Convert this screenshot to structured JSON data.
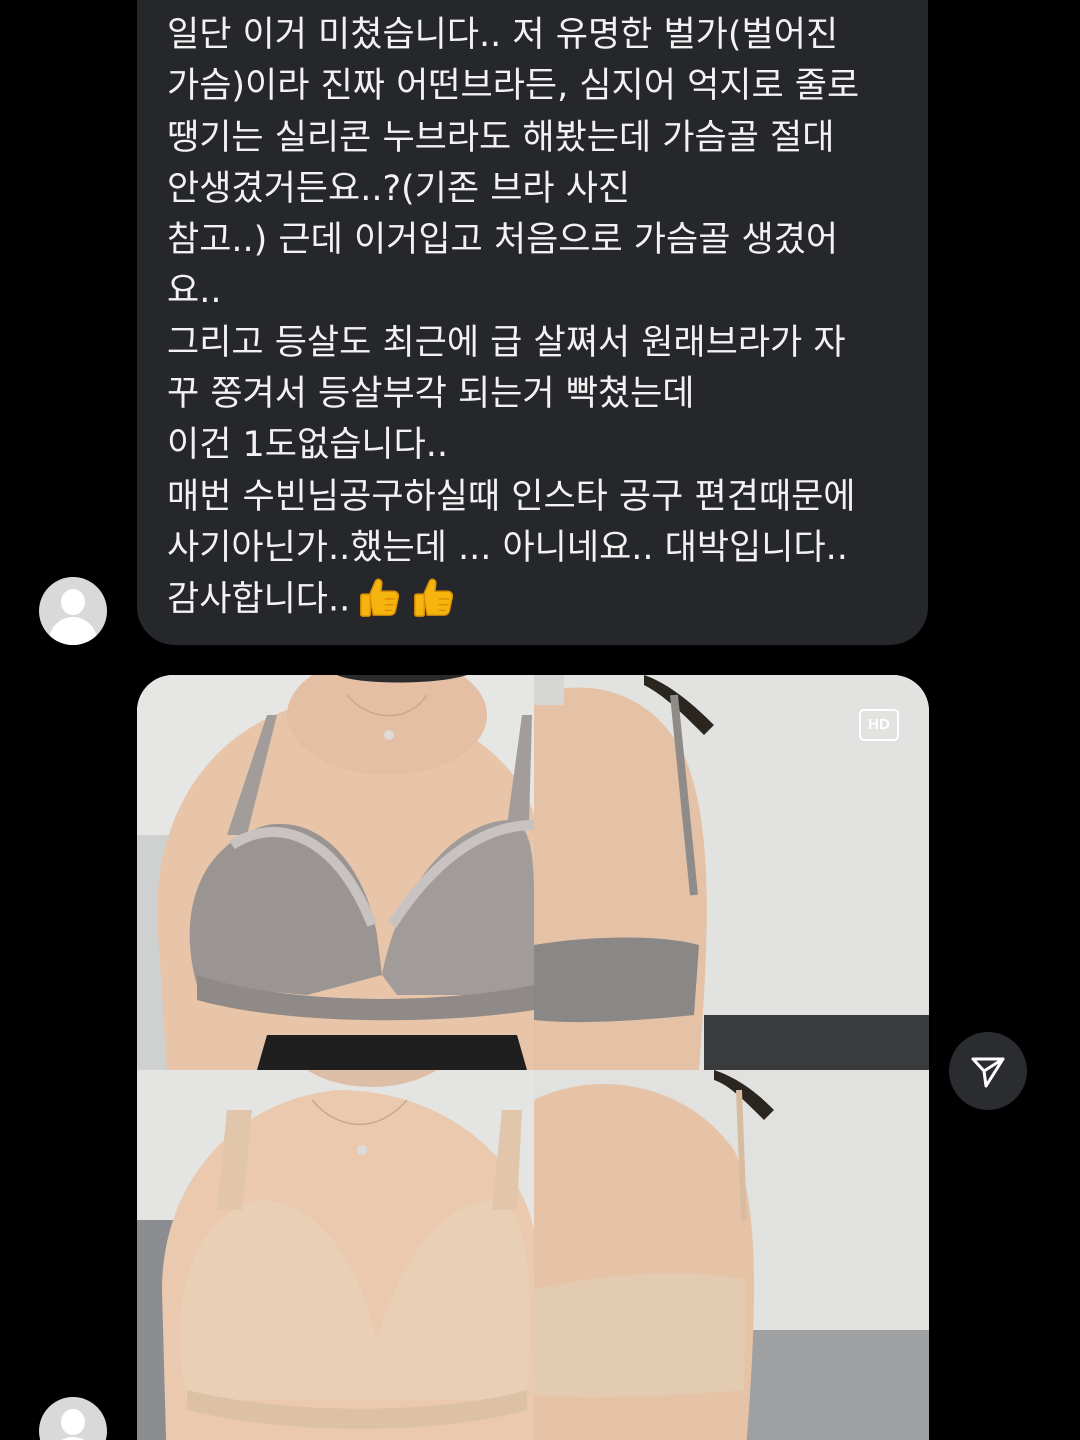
{
  "message": {
    "lines": [
      "일단 이거 미쳤습니다.. 저 유명한 벌가(벌어진",
      "가슴)이라 진짜 어떤브라든, 심지어 억지로 줄로",
      "땡기는 실리콘 누브라도 해봤는데 가슴골 절대",
      "안생겼거든요..?(기존 브라 사진",
      "참고..) 근데 이거입고 처음으로 가슴골 생겼어",
      "요..",
      "그리고 등살도 최근에 급 살쪄서 원래브라가 자",
      "꾸 쫑겨서 등살부각 되는거 빡쳤는데",
      "이건 1도없습니다..",
      "매번 수빈님공구하실때 인스타 공구 편견때문에",
      "사기아닌가..했는데 ... 아니네요.. 대박입니다..",
      "감사합니다.."
    ],
    "emoji": [
      "thumbs-up",
      "thumbs-up"
    ]
  },
  "photo": {
    "hd_label": "HD",
    "panels": [
      "before-front",
      "before-back",
      "after-front",
      "after-back"
    ]
  },
  "colors": {
    "background": "#000000",
    "bubble": "#25272b",
    "text": "#f2f2f2",
    "share_button": "#2a2c30"
  },
  "icons": {
    "share": "paper-plane-icon",
    "avatar": "default-avatar-icon"
  }
}
